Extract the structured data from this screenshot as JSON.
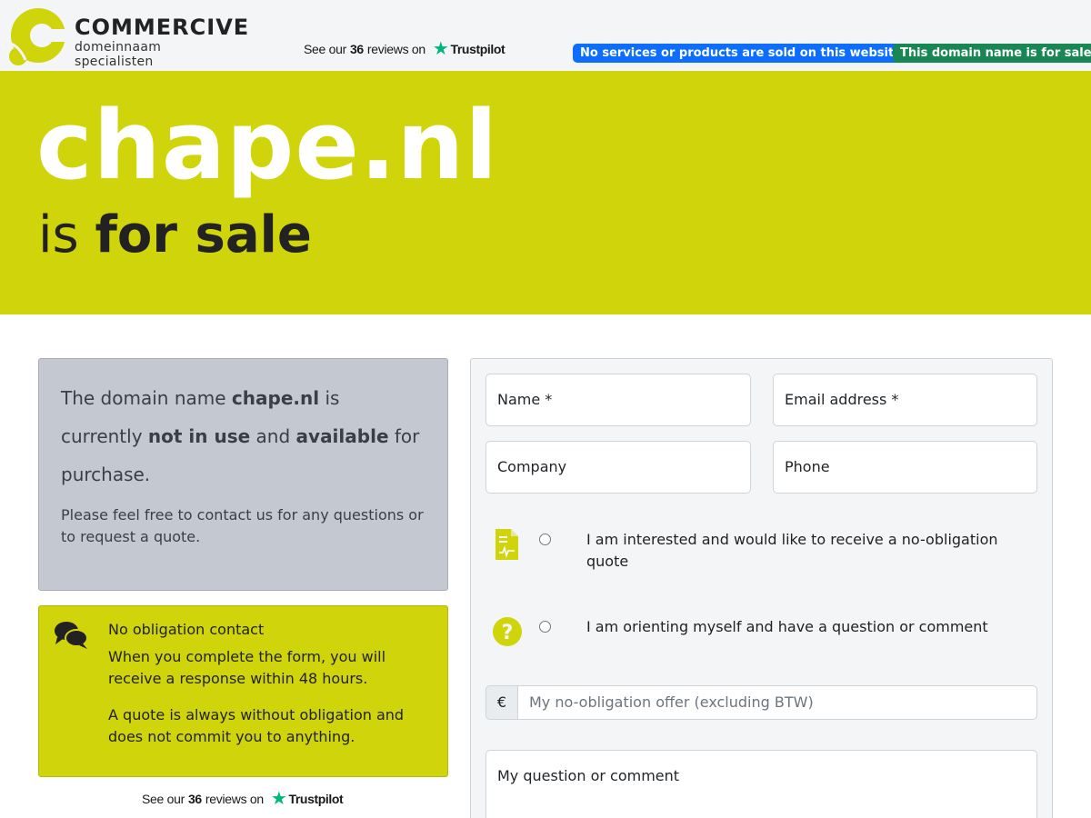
{
  "header": {
    "logo_name": "COMMERCIVE",
    "logo_tagline": "domeinnaam specialisten",
    "trustpilot": {
      "prefix": "See our",
      "count": "36",
      "middle": "reviews on",
      "brand": "Trustpilot"
    },
    "badges": {
      "no_services": "No services or products are sold on this website.",
      "for_sale": "This domain name is for sale"
    }
  },
  "hero": {
    "domain": "chape.nl",
    "is": "is",
    "for_sale": "for sale"
  },
  "intro": {
    "p1": "The domain name",
    "domain": "chape.nl",
    "p2": "is currently",
    "not_in_use": "not in use",
    "and": "and",
    "available": "available",
    "p3": "for purchase.",
    "sub": "Please feel free to contact us for any questions or to request a quote."
  },
  "obligation": {
    "title": "No obligation contact",
    "text1": "When you complete the form, you will receive a response within 48 hours.",
    "text2": "A quote is always without obligation and does not commit you to anything."
  },
  "form": {
    "name": "Name *",
    "email": "Email address *",
    "company": "Company",
    "phone": "Phone",
    "option_quote": "I am interested and would like to receive a no-obligation quote",
    "option_question": "I am orienting myself and have a question or comment",
    "currency": "€",
    "offer_placeholder": "My no-obligation offer (excluding BTW)",
    "comment": "My question or comment"
  },
  "colors": {
    "accent": "#d0d40a",
    "blue": "#0d6efd",
    "green": "#198754",
    "trustpilot": "#00b67a"
  },
  "icons": [
    "commercive-logo-icon",
    "trustpilot-star-icon",
    "chat-bubbles-icon",
    "document-icon",
    "question-circle-icon"
  ]
}
